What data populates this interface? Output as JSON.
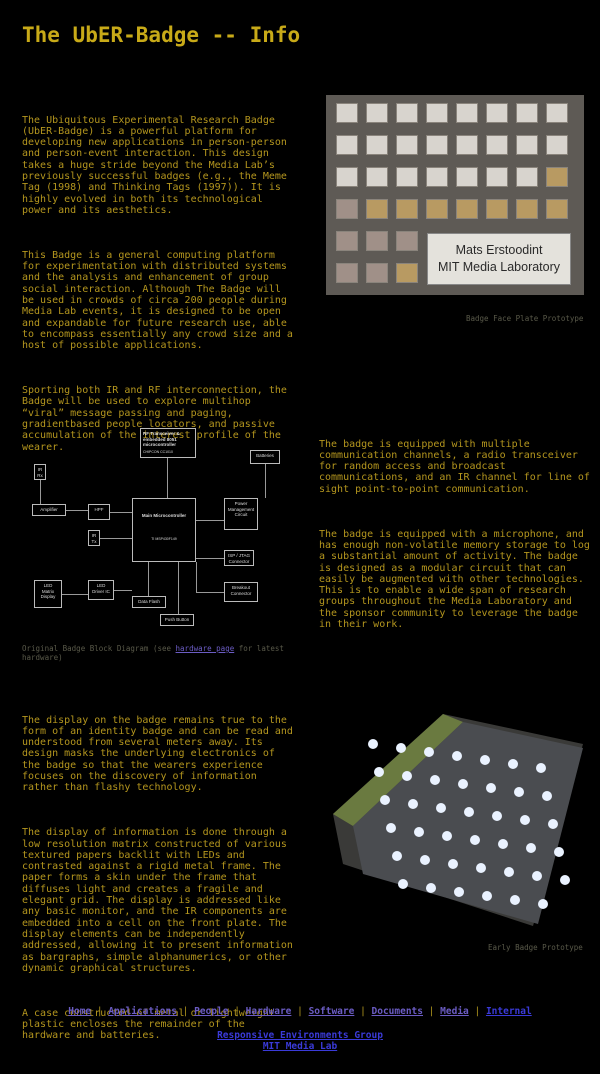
{
  "title": "The UbER-Badge -- Info",
  "intro": {
    "p1": "The Ubiquitous Experimental Research Badge\n(UbER-Badge) is a powerful platform for\ndeveloping new applications in person-person\nand person-event interaction. This design\ntakes a huge stride beyond the Media Lab’s\npreviously successful badges (e.g., the Meme\nTag (1998) and Thinking Tags (1997)). It is\nhighly evolved in both its technological\npower and its aesthetics.",
    "p2": "This Badge is a general computing platform\nfor experimentation with distributed systems\nand the analysis and enhancement of group\nsocial interaction. Although The Badge will\nbe used in crowds of circa 200 people during\nMedia Lab events, it is designed to be open\nand expandable for future research use, able\nto encompass essentially any crowd size and a\nhost of possible applications.",
    "p3": "Sporting both IR and RF interconnection, the\nBadge will be used to explore multihop\n“viral” message passing and paging,\ngradientbased people locators, and passive\naccumulation of the interest profile of the\nwearer."
  },
  "badge_photo": {
    "nameplate_line1": "Mats Erstoodint",
    "nameplate_line2": "MIT Media Laboratory",
    "caption": "Badge Face Plate Prototype"
  },
  "hardware": {
    "p1": "The badge is equipped with multiple\ncommunication channels, a radio transceiver\nfor random access and broadcast\ncommunications, and an IR channel for line of\nsight point-to-point communication.",
    "p2": "The badge is equipped with a microphone, and\nhas enough non-volatile memory storage to log\na substantial amount of activity. The badge\nis designed as a modular circuit that can\neasily be augmented with other technologies.\nThis is to enable a wide span of research\ngroups throughout the Media Laboratory and\nthe sponsor community to leverage the badge\nin their work."
  },
  "diagram": {
    "rf": "RF Transceiver & embedded 8051 microcontroller",
    "rf_sub": "CHIPCON CC1010",
    "batteries": "Batteries",
    "ir_rx": "IR Rx",
    "amplifier": "Amplifier",
    "hpf": "HPF",
    "main": "Main Microcontroller",
    "main_sub": "TI MSP430F149",
    "power": "Power Management Circuit",
    "ir_tx": "IR Tx",
    "isp": "ISP / JTAG Connector",
    "breakout": "Breakout Connector",
    "led_matrix": "LED Matrix Display",
    "led_driver": "LED Driver IC",
    "data_flash": "Data Flash",
    "push_button": "Push Button",
    "caption_pre": "Original Badge Block Diagram (see ",
    "caption_link": "hardware page",
    "caption_post": " for latest hardware)"
  },
  "display": {
    "p1": "The display on the badge remains true to the\nform of an identity badge and can be read and\nunderstood from several meters away. Its\ndesign masks the underlying electronics of\nthe badge so that the wearers experience\nfocuses on the discovery of information\nrather than flashy technology.",
    "p2": "The display of information is done through a\nlow resolution matrix constructed of various\ntextured papers backlit with LEDs and\ncontrasted against a rigid metal frame. The\npaper forms a skin under the frame that\ndiffuses light and creates a fragile and\nelegant grid. The display is addressed like\nany basic monitor, and the IR components are\nembedded into a cell on the front plate. The\ndisplay elements can be independently\naddressed, allowing it to present information\nas bargraphs, simple alphanumerics, or other\ndynamic graphical structures.",
    "p3": "A case constructed of metal or lightweight\nplastic encloses the remainder of the\nhardware and batteries."
  },
  "led_photo": {
    "caption": "Early Badge Prototype"
  },
  "nav": {
    "items": [
      "Home",
      "Applications",
      "People",
      "Hardware",
      "Software",
      "Documents",
      "Media",
      "Internal"
    ],
    "sep": " | "
  },
  "footer": {
    "group": "Responsive Environments Group",
    "lab": "MIT Media Lab"
  }
}
